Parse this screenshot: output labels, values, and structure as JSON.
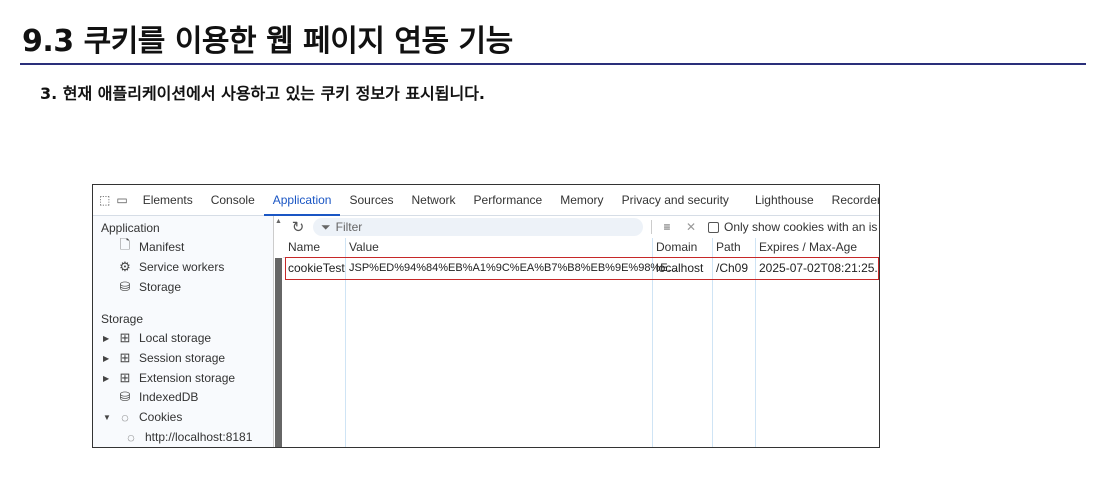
{
  "slide": {
    "title": "9.3 쿠키를 이용한 웹 페이지 연동 기능",
    "subtitle": "3. 현재 애플리케이션에서 사용하고 있는 쿠키 정보가 표시됩니다."
  },
  "devtools": {
    "tabs": [
      "Elements",
      "Console",
      "Application",
      "Sources",
      "Network",
      "Performance",
      "Memory",
      "Privacy and security",
      "Lighthouse",
      "Recorder"
    ],
    "active_tab": "Application",
    "sidebar": {
      "app_header": "Application",
      "app_items": [
        "Manifest",
        "Service workers",
        "Storage"
      ],
      "storage_header": "Storage",
      "storage_items": [
        "Local storage",
        "Session storage",
        "Extension storage",
        "IndexedDB",
        "Cookies"
      ],
      "cookie_child": "http://localhost:8181"
    },
    "toolbar": {
      "filter_placeholder": "Filter",
      "only_show_label": "Only show cookies with an is"
    },
    "table": {
      "headers": [
        "Name",
        "Value",
        "Domain",
        "Path",
        "Expires / Max-Age"
      ],
      "rows": [
        [
          "cookieTest",
          "JSP%ED%94%84%EB%A1%9C%EA%B7%B8%EB%9E%98%E...",
          "localhost",
          "/Ch09",
          "2025-07-02T08:21:25..."
        ]
      ]
    }
  }
}
